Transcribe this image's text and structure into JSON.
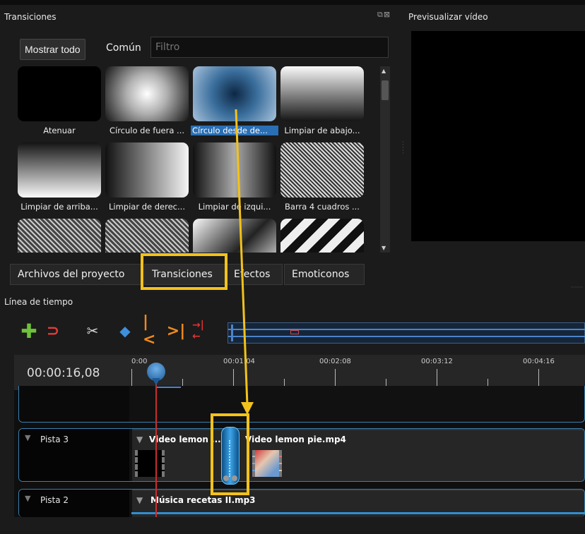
{
  "transitions_panel": {
    "title": "Transiciones",
    "show_all_label": "Mostrar todo",
    "common_label": "Común",
    "filter_placeholder": "Filtro",
    "items": [
      {
        "label": "Atenuar",
        "icon": "fade-thumbnail"
      },
      {
        "label": "Círculo de fuera ...",
        "icon": "circle-out-thumbnail"
      },
      {
        "label": "Círculo desde de...",
        "icon": "circle-in-thumbnail",
        "selected": true
      },
      {
        "label": "Limpiar de abajo...",
        "icon": "wipe-bottom-thumbnail"
      },
      {
        "label": "Limpiar de arriba...",
        "icon": "wipe-top-thumbnail"
      },
      {
        "label": "Limpiar de derec...",
        "icon": "wipe-right-thumbnail"
      },
      {
        "label": "Limpiar de izqui...",
        "icon": "wipe-left-thumbnail"
      },
      {
        "label": "Barra 4 cuadros ...",
        "icon": "bar-4-squares-thumbnail"
      },
      {
        "label": "",
        "icon": "concentric-thumbnail"
      },
      {
        "label": "",
        "icon": "concentric-2-thumbnail"
      },
      {
        "label": "",
        "icon": "diagonal-thumbnail"
      },
      {
        "label": "",
        "icon": "diagonal-stripes-thumbnail"
      }
    ]
  },
  "preview_panel": {
    "title": "Previsualizar vídeo"
  },
  "tabs": [
    {
      "label": "Archivos del proyecto"
    },
    {
      "label": "Transiciones",
      "active": true
    },
    {
      "label": "Efectos"
    },
    {
      "label": "Emoticonos"
    }
  ],
  "timeline": {
    "title": "Línea de tiempo",
    "timecode": "00:00:16,08",
    "ticks": [
      "0:00",
      "00:01:04",
      "00:02:08",
      "00:03:12",
      "00:04:16"
    ],
    "toolbar_icons": [
      "add-track-icon",
      "snap-magnet-icon",
      "razor-icon",
      "add-marker-icon",
      "previous-marker-icon",
      "next-marker-icon",
      "center-playhead-icon"
    ],
    "tracks": [
      {
        "name": "Pista 3",
        "clips": [
          {
            "title": "Video lemon ..."
          },
          {
            "title": "Video lemon pie.mp4"
          }
        ]
      },
      {
        "name": "Pista 2",
        "clips": [
          {
            "title": "Música recetas II.mp3"
          }
        ]
      }
    ]
  },
  "colors": {
    "highlight": "#f3c21a",
    "selection": "#2a6fb4",
    "playhead": "#c92d2d",
    "track_border": "#3a7fb0"
  }
}
